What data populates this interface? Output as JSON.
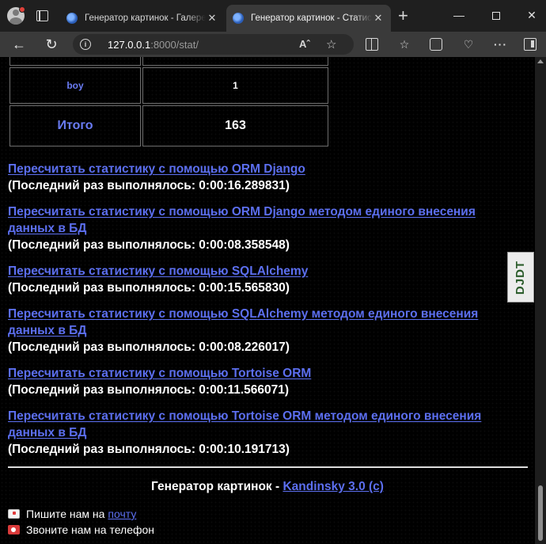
{
  "browser": {
    "tabs": [
      {
        "title": "Генератор картинок - Галерея",
        "close": "✕",
        "active": false
      },
      {
        "title": "Генератор картинок - Статистика",
        "close": "✕",
        "active": true
      }
    ],
    "new_tab": "+",
    "window": {
      "min": "—",
      "close": "✕"
    },
    "url": {
      "host": "127.0.0.1",
      "rest": ":8000/stat/"
    },
    "reader_label": "Aˆ",
    "icons": {
      "back": "←",
      "reload": "↻",
      "info": "i",
      "favorite": "☆",
      "favorites": "☆",
      "health": "♡",
      "more": "···"
    }
  },
  "stats_table": {
    "rows": [
      {
        "label": "",
        "value": ""
      },
      {
        "label": "boy",
        "value": "1"
      },
      {
        "label": "Итого",
        "value": "163"
      }
    ]
  },
  "recalc": [
    {
      "link": "Пересчитать статистику с помощью ORM Django",
      "last": "(Последний раз выполнялось: 0:00:16.289831)"
    },
    {
      "link": "Пересчитать статистику с помощью ORM Django методом единого внесения данных в БД",
      "last": "(Последний раз выполнялось: 0:00:08.358548)"
    },
    {
      "link": "Пересчитать статистику с помощью SQLAlchemy",
      "last": "(Последний раз выполнялось: 0:00:15.565830)"
    },
    {
      "link": "Пересчитать статистику с помощью SQLAlchemy методом единого внесения данных в БД",
      "last": "(Последний раз выполнялось: 0:00:08.226017)"
    },
    {
      "link": "Пересчитать статистику с помощью Tortoise ORM",
      "last": "(Последний раз выполнялось: 0:00:11.566071)"
    },
    {
      "link": "Пересчитать статистику с помощью Tortoise ORM методом единого внесения данных в БД",
      "last": "(Последний раз выполнялось: 0:00:10.191713)"
    }
  ],
  "footer": {
    "brand": "Генератор картинок",
    "separator": " - ",
    "model_link": "Kandinsky 3.0 (c)",
    "mail_text": "Пишите нам на",
    "mail_link": "почту",
    "phone_text": "Звоните нам на телефон"
  },
  "djdt_label": "DJDT",
  "colors": {
    "link": "#5c6ff0",
    "background": "#000000",
    "chrome": "#3a3a3a"
  }
}
